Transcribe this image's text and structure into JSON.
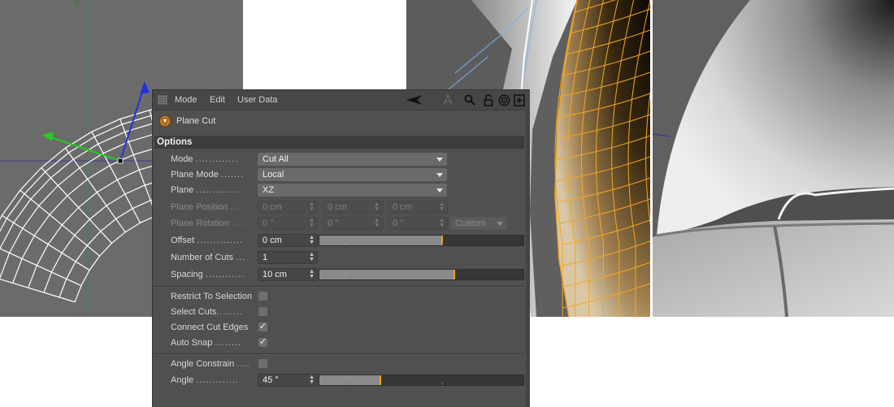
{
  "menu": {
    "items": [
      "Mode",
      "Edit",
      "User Data"
    ]
  },
  "toolbar": {
    "icons": [
      "back-arrow-icon",
      "text-a-icon",
      "search-icon",
      "lock-icon",
      "target-icon",
      "new-panel-icon"
    ]
  },
  "object": {
    "name": "Plane Cut",
    "icon": "plane-cut-icon"
  },
  "options": {
    "header": "Options",
    "mode": {
      "label": "Mode",
      "value": "Cut All"
    },
    "plane_mode": {
      "label": "Plane Mode",
      "value": "Local"
    },
    "plane": {
      "label": "Plane",
      "value": "XZ"
    },
    "plane_position": {
      "label": "Plane Position",
      "x": "0 cm",
      "y": "0 cm",
      "z": "0 cm"
    },
    "plane_rotation": {
      "label": "Plane Rotation",
      "x": "0 °",
      "y": "0 °",
      "z": "0 °",
      "preset": "Custom"
    },
    "offset": {
      "label": "Offset",
      "value": "0 cm",
      "slider_fraction": 0.6
    },
    "number_of_cuts": {
      "label": "Number of Cuts",
      "value": "1"
    },
    "spacing": {
      "label": "Spacing",
      "value": "10 cm",
      "slider_fraction": 0.66
    },
    "restrict_to_selection": {
      "label": "Restrict To Selection",
      "checked": false
    },
    "select_cuts": {
      "label": "Select Cuts",
      "checked": false
    },
    "connect_cut_edges": {
      "label": "Connect Cut Edges",
      "checked": true
    },
    "auto_snap": {
      "label": "Auto Snap",
      "checked": true
    },
    "angle_constrain": {
      "label": "Angle Constrain",
      "checked": false
    },
    "angle": {
      "label": "Angle",
      "value": "45 °",
      "slider_fraction": 0.3
    }
  },
  "check_glyph": "✓",
  "colors": {
    "accent_orange": "#f0a020",
    "panel_bg": "#505050",
    "selection_orange": "#f5a623",
    "axis_green": "#22cc22",
    "axis_blue": "#2233dd"
  }
}
